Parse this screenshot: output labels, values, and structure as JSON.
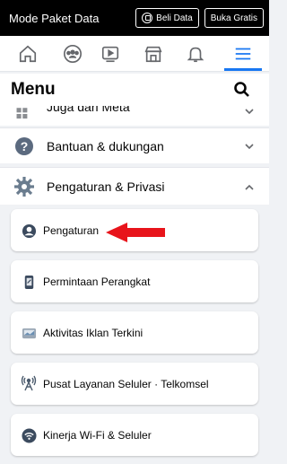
{
  "statusbar": {
    "mode_text": "Mode Paket Data",
    "buy_label": "Beli Data",
    "free_label": "Buka Gratis"
  },
  "nav": {
    "icons": [
      "home-icon",
      "groups-icon",
      "watch-icon",
      "marketplace-icon",
      "notifications-icon",
      "menu-icon"
    ],
    "active": "menu-icon",
    "accent": "#1877f2"
  },
  "menu": {
    "title": "Menu",
    "partial_row": "Juga dari Meta",
    "help_row": "Bantuan & dukungan",
    "settings_row": "Pengaturan & Privasi"
  },
  "cards": [
    {
      "label": "Pengaturan",
      "icon": "profile-icon"
    },
    {
      "label": "Permintaan Perangkat",
      "icon": "device-icon"
    },
    {
      "label": "Aktivitas Iklan Terkini",
      "icon": "ad-activity-icon"
    },
    {
      "label": "Pusat Layanan Seluler · Telkomsel",
      "icon": "cellular-icon"
    },
    {
      "label": "Kinerja Wi-Fi & Seluler",
      "icon": "wifi-icon"
    }
  ],
  "annotation": {
    "arrow_color": "#e8141b"
  }
}
